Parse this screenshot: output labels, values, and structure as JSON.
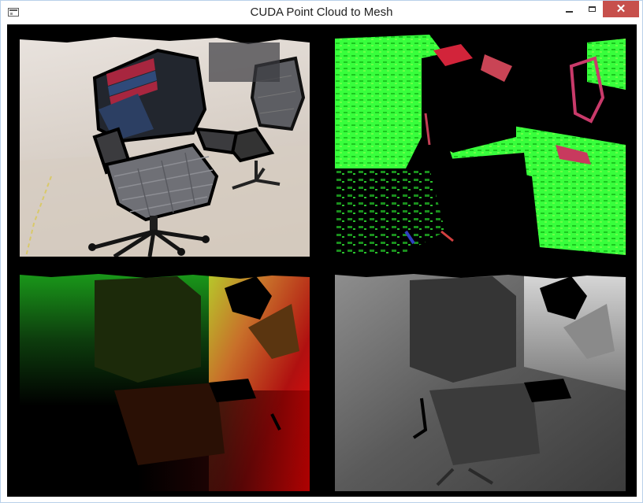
{
  "window": {
    "title": "CUDA Point Cloud to Mesh",
    "icons": {
      "app": "app-window-icon",
      "minimize": "minimize-icon",
      "maximize": "maximize-icon",
      "close": "close-icon"
    },
    "close_glyph": "✕",
    "close_color": "#c7504c"
  },
  "views": [
    {
      "id": "color-image",
      "kind": "RGB camera image of office chair"
    },
    {
      "id": "normal-map",
      "kind": "surface normals (green/red/black)"
    },
    {
      "id": "vertex-map",
      "kind": "vertex coordinates (red/green gradient)"
    },
    {
      "id": "depth-map",
      "kind": "grayscale depth"
    }
  ]
}
